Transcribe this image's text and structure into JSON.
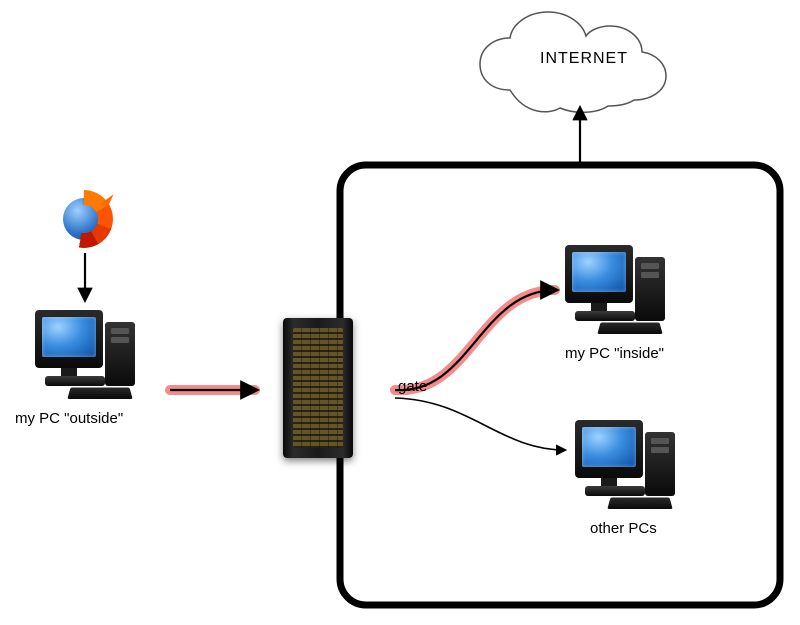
{
  "diagram": {
    "internet_label": "INTERNET",
    "outside_pc_label": "my PC \"outside\"",
    "inside_pc_label": "my PC \"inside\"",
    "other_pcs_label": "other PCs",
    "gate_label": "gate"
  },
  "icons": {
    "browser": "firefox-icon",
    "server": "server-rack-icon",
    "pc": "desktop-pc-icon",
    "cloud": "cloud-icon"
  },
  "colors": {
    "highlight_arrow": "#f58a8a",
    "highlight_arrow_core": "#000000",
    "box_stroke": "#000000",
    "cloud_stroke": "#555555"
  }
}
